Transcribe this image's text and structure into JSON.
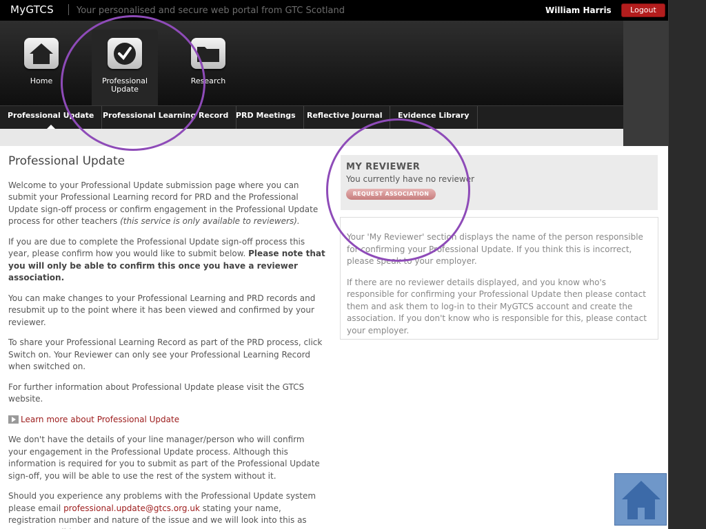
{
  "topbar": {
    "brand": "MyGTCS",
    "tagline": "Your personalised and secure web portal from GTC Scotland",
    "username": "William Harris",
    "logout_label": "Logout"
  },
  "apps": [
    {
      "label": "Home",
      "icon": "home-icon"
    },
    {
      "label": "Professional Update",
      "icon": "checkmark-icon",
      "active": true
    },
    {
      "label": "Research",
      "icon": "folder-icon"
    }
  ],
  "tabs": [
    {
      "label": "Professional Update",
      "active": true
    },
    {
      "label": "Professional Learning Record"
    },
    {
      "label": "PRD Meetings"
    },
    {
      "label": "Reflective Journal"
    },
    {
      "label": "Evidence Library"
    }
  ],
  "main": {
    "title": "Professional Update",
    "p1": "Welcome to your Professional Update submission page where you can submit your Professional Learning record for PRD and the Professional Update sign-off process or confirm engagement in the Professional Update process for other teachers",
    "p1_note": "(this service is only available to reviewers).",
    "p2": "If you are due to complete the Professional Update sign-off process this year, please confirm how you would like to submit below.",
    "p2_bold": "Please note that you will only be able to confirm this once you have a reviewer association.",
    "p3": "You can make changes to your Professional Learning and PRD records and resubmit up to the point where it has been viewed and confirmed by your reviewer.",
    "p4": "To share your Professional Learning Record as part of the PRD process, click Switch on. Your Reviewer can only see your Professional Learning Record when switched on.",
    "p5": "For further information about Professional Update please visit the GTCS website.",
    "learn_more": "Learn more about Professional Update",
    "p6": "We don't have the details of your line manager/person who will confirm your engagement in the Professional Update process. Although this information is required for you to submit as part of the Professional Update sign-off, you will be able to use the rest of the system without it.",
    "p7_a": "Should you experience any problems with the Professional Update system please email",
    "email": "professional.update@gtcs.org.uk",
    "p7_b": "stating your name, registration number and nature of the issue and we will look into this as soon as possible."
  },
  "reviewer": {
    "heading": "MY REVIEWER",
    "status": "You currently have no reviewer",
    "button_label": "REQUEST ASSOCIATION",
    "info1": "Your 'My Reviewer' section displays the name of the person responsible for confirming your Professional Update. If you think this is incorrect, please speak to your employer.",
    "info2": "If there are no reviewer details displayed, and you know who's responsible for confirming your Professional Update then please contact them and ask them to log-in to their MyGTCS account and create the association. If you don't know who is responsible for this, please contact your employer."
  },
  "colors": {
    "accent_red": "#b31d1d",
    "annotation_purple": "#8e4bb8",
    "home_button_blue": "#6f97c9"
  }
}
